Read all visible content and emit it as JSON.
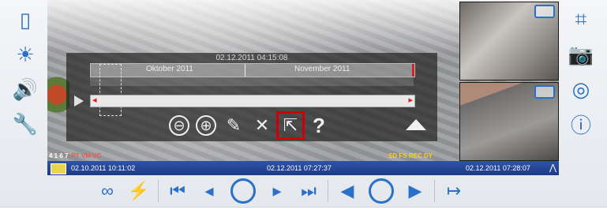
{
  "left_toolbar": {
    "items": [
      {
        "icon": "door-icon",
        "glyph": "▯"
      },
      {
        "icon": "light-icon",
        "glyph": "☀"
      },
      {
        "icon": "speaker-icon",
        "glyph": "🔊"
      },
      {
        "icon": "wrench-icon",
        "glyph": "🔧"
      }
    ]
  },
  "right_toolbar": {
    "items": [
      {
        "icon": "crop-icon",
        "glyph": "⌗"
      },
      {
        "icon": "camera-icon",
        "glyph": "📷"
      },
      {
        "icon": "lifebuoy-icon",
        "glyph": "◎"
      },
      {
        "icon": "info-icon",
        "glyph": "ⓘ"
      }
    ]
  },
  "overlay": {
    "timestamp": "02.12.2011 04:15:08",
    "timeline": {
      "month1": "Oktober 2011",
      "month2": "November 2011"
    },
    "tools": {
      "zoom_out": "⊖",
      "zoom_in": "⊕",
      "marker": "✎",
      "close": "✕",
      "export": "⇱",
      "help": "?"
    }
  },
  "status": {
    "channels": "4 1 6 7",
    "flags": "PT VM VC",
    "rec": "SD FS REC DY"
  },
  "datebar": {
    "start": "02.10.2011 10:11:02",
    "current": "02.12.2011 07:27:37",
    "end": "02.12.2011 07:28:07"
  },
  "bottom_toolbar": {
    "items": [
      {
        "icon": "link-icon",
        "glyph": "∞"
      },
      {
        "icon": "alarm-frame-icon",
        "glyph": "⚡"
      },
      {
        "icon": "skip-first-icon",
        "glyph": "⏮"
      },
      {
        "icon": "prev-event-icon",
        "glyph": "◂"
      },
      {
        "icon": "play-round-icon",
        "glyph": ""
      },
      {
        "icon": "next-event-icon",
        "glyph": "▸"
      },
      {
        "icon": "skip-last-icon",
        "glyph": "⏭"
      },
      {
        "icon": "rewind-icon",
        "glyph": "◀"
      },
      {
        "icon": "play-center-icon",
        "glyph": ""
      },
      {
        "icon": "forward-icon",
        "glyph": "▶"
      },
      {
        "icon": "jump-to-end-icon",
        "glyph": "↦"
      }
    ]
  },
  "colors": {
    "accent": "#2a6fc8",
    "date_bar": "#1d3a86",
    "selection": "#d00000",
    "rec_text": "#ffd200"
  }
}
